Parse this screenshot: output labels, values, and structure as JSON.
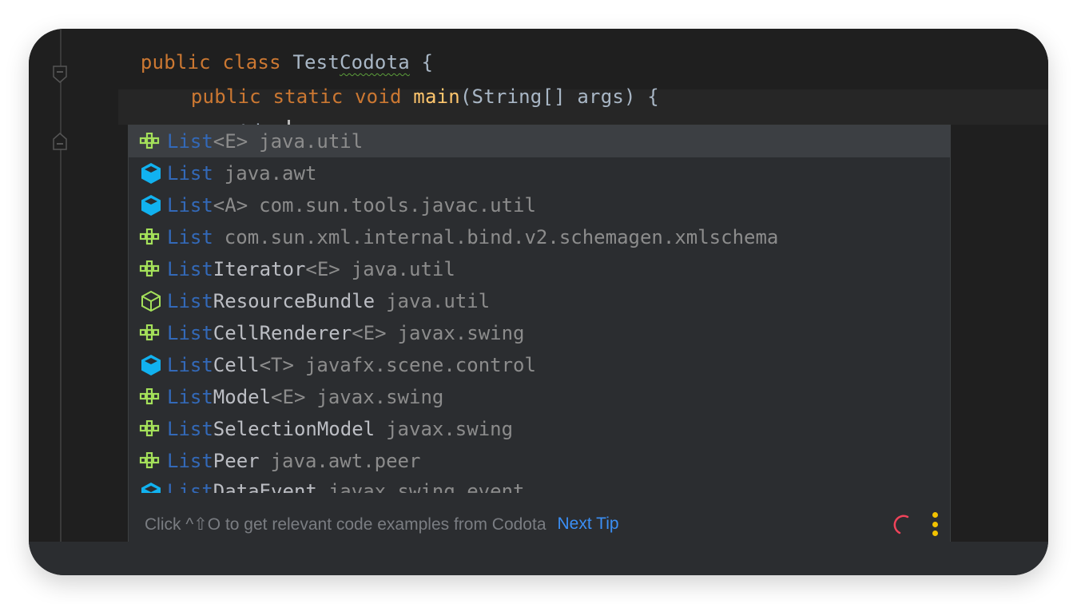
{
  "editor": {
    "lines": {
      "line1": {
        "kw1": "public",
        "kw2": "class",
        "name_a": "Test",
        "name_b": "Codota",
        "brace": "{"
      },
      "line2": {
        "kw1": "public",
        "kw2": "static",
        "kw3": "void",
        "fn": "main",
        "params": "(String[] args) {"
      },
      "line3": {
        "typed": "List"
      },
      "line4": {
        "text": "}"
      },
      "line5": {
        "text": "}"
      }
    }
  },
  "completion": {
    "items": [
      {
        "icon": "interface-icon",
        "match": "List",
        "rest": "",
        "generic": "<E>",
        "pkg": "java.util",
        "selected": true
      },
      {
        "icon": "class-icon",
        "match": "List",
        "rest": "",
        "generic": "",
        "pkg": "java.awt"
      },
      {
        "icon": "class-icon",
        "match": "List",
        "rest": "",
        "generic": "<A>",
        "pkg": "com.sun.tools.javac.util"
      },
      {
        "icon": "interface-icon",
        "match": "List",
        "rest": "",
        "generic": "",
        "pkg": "com.sun.xml.internal.bind.v2.schemagen.xmlschema"
      },
      {
        "icon": "interface-icon",
        "match": "List",
        "rest": "Iterator",
        "generic": "<E>",
        "pkg": "java.util"
      },
      {
        "icon": "abstract-class-icon",
        "match": "List",
        "rest": "ResourceBundle",
        "generic": "",
        "pkg": "java.util"
      },
      {
        "icon": "interface-icon",
        "match": "List",
        "rest": "CellRenderer",
        "generic": "<E>",
        "pkg": "javax.swing"
      },
      {
        "icon": "class-icon",
        "match": "List",
        "rest": "Cell",
        "generic": "<T>",
        "pkg": "javafx.scene.control"
      },
      {
        "icon": "interface-icon",
        "match": "List",
        "rest": "Model",
        "generic": "<E>",
        "pkg": "javax.swing"
      },
      {
        "icon": "interface-icon",
        "match": "List",
        "rest": "SelectionModel",
        "generic": "",
        "pkg": "javax.swing"
      },
      {
        "icon": "interface-icon",
        "match": "List",
        "rest": "Peer",
        "generic": "",
        "pkg": "java.awt.peer"
      },
      {
        "icon": "class-icon",
        "match": "List",
        "rest": "DataEvent",
        "generic": "",
        "pkg": "javax.swing.event"
      }
    ],
    "footer": {
      "tip": "Click ^⇧O to get relevant code examples from Codota",
      "next_tip": "Next Tip"
    }
  },
  "colors": {
    "keyword": "#cc7832",
    "function": "#ffc66d",
    "match": "#3369b8",
    "interface_icon": "#a4e05a",
    "class_icon": "#11b2f0",
    "link": "#3b8ff5",
    "spinner": "#f0435a",
    "menu": "#f2c200"
  }
}
